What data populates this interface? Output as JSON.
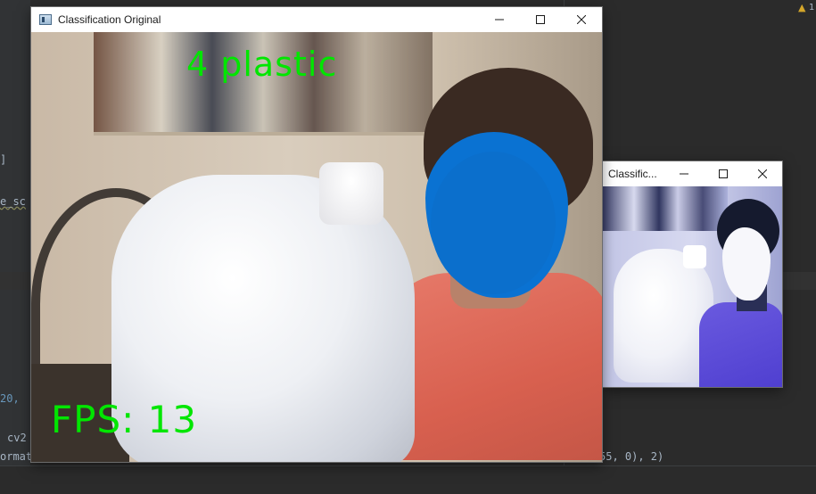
{
  "ide": {
    "snippets": [
      {
        "id": "bracket",
        "text": "]"
      },
      {
        "id": "score",
        "text": "e_sc"
      },
      {
        "id": "num20",
        "text": "20,"
      },
      {
        "id": "cv2",
        "text": "cv2"
      },
      {
        "id": "format",
        "text": "ormat"
      },
      {
        "id": "tail",
        "text": "55, 0), 2)"
      }
    ],
    "warning_count": "1"
  },
  "windows": {
    "main": {
      "title": "Classification Original",
      "label_text": "4 plastic",
      "fps_text": "FPS: 13"
    },
    "small": {
      "title": "Classific..."
    }
  },
  "icons": {
    "minimize": "minimize-icon",
    "maximize": "maximize-icon",
    "close": "close-icon",
    "app": "app-icon",
    "warning": "warning-icon"
  },
  "colors": {
    "overlay_text": "#00e600",
    "face_blur": "#0a72d2"
  }
}
